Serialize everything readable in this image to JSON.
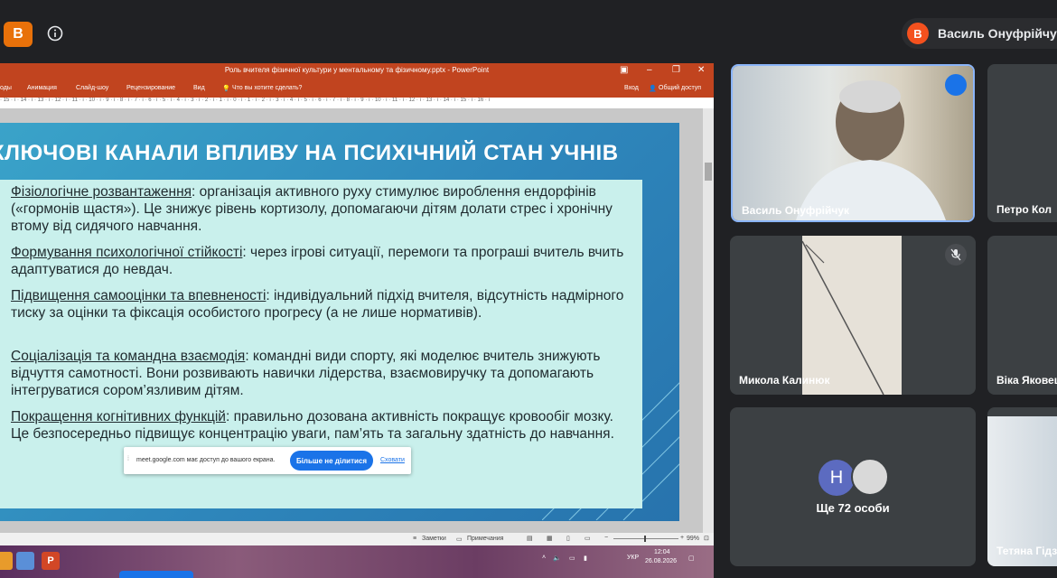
{
  "meet": {
    "logo_label": "B",
    "presenter_avatar_letter": "B",
    "presenter_name": "Василь Онуфрійчук",
    "participants_more": "Ще 72 особи",
    "others_avatar_letter": "Н"
  },
  "ppt": {
    "window_title": "Роль вчителя фізичної культури у ментальному та фізичному.pptx - PowerPoint",
    "ribbon_tabs": [
      "оды",
      "Анимация",
      "Слайд-шоу",
      "Рецензирование",
      "Вид"
    ],
    "tell_me": "Что вы хотите сделать?",
    "sign_in": "Вход",
    "share": "Общий доступ",
    "ruler": "· 15 · ı · 14 · ı · 13 · ı · 12 · ı · 11 · ı · 10 · ı · 9 · ı · 8 · ı · 7 · ı · 6 · ı · 5 · ı · 4 · ı · 3 · ı · 2 · ı · 1 · ı · 0 · ı · 1 · ı · 2 · ı · 3 · ı · 4 · ı · 5 · ı · 6 · ı · 7 · ı · 8 · ı · 9 · ı · 10 · ı · 11 · ı · 12 · ı · 13 · ı · 14 · ı · 15 · ı · 16 · ı",
    "status_notes": "Заметки",
    "status_comments": "Примечания",
    "zoom": "99%"
  },
  "slide": {
    "heading": "КЛЮЧОВІ КАНАЛИ ВПЛИВУ НА ПСИХІЧНИЙ СТАН УЧНІВ",
    "bullets": [
      {
        "title": "Фізіологічне розвантаження",
        "text": ": організація активного руху стимулює вироблення ендорфінів («гормонів щастя»). Це знижує рівень кортизолу, допомагаючи дітям долати стрес і хронічну втому від сидячого навчання."
      },
      {
        "title": "Формування психологічної стійкості",
        "text": ": через ігрові ситуації, перемоги та програші вчитель вчить адаптуватися до невдач."
      },
      {
        "title": "Підвищення самооцінки та впевненості",
        "text": ": індивідуальний підхід вчителя, відсутність надмірного тиску за оцінки та фіксація особистого прогресу (а не лише нормативів)."
      },
      {
        "title": "Соціалізація та командна взаємодія",
        "text": ": командні види спорту, які моделює вчитель знижують відчуття самотності. Вони розвивають навички лідерства, взаємовиручку та допомагають інтегруватися сором’язливим дітям."
      },
      {
        "title": "Покращення когнітивних функцій",
        "text": ": правильно дозована активність покращує кровообіг мозку. Це безпосередньо підвищує концентрацію уваги, пам’ять та загальну здатність до навчання."
      }
    ]
  },
  "share_bar": {
    "message": "meet.google.com має доступ до вашого екрана.",
    "stop_button": "Більше не ділитися",
    "hide_link": "Сховати"
  },
  "taskbar": {
    "time": "12:04",
    "date": "26.08.2026",
    "lang": "УКР"
  },
  "tiles": [
    {
      "name": "Василь Онуфрійчук"
    },
    {
      "name": "Петро Кол"
    },
    {
      "name": "Микола Калинюк"
    },
    {
      "name": "Віка Яковец"
    },
    {
      "name": "Тетяна Гідз"
    }
  ],
  "colors": {
    "meet_bg": "#202124",
    "ppt_accent": "#c1441f",
    "slide_box": "#c9f0ec",
    "share_blue": "#1a73e8"
  }
}
